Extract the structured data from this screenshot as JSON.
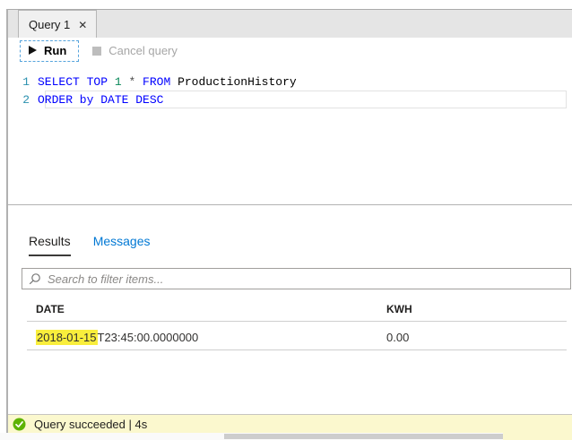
{
  "tab_bar": {
    "tabs": [
      {
        "label": "Query 1"
      }
    ],
    "close_icon": "✕"
  },
  "toolbar": {
    "run_label": "Run",
    "cancel_label": "Cancel query"
  },
  "editor": {
    "lines": [
      {
        "number": "1",
        "tokens": [
          {
            "text": "SELECT TOP ",
            "type": "keyword"
          },
          {
            "text": "1",
            "type": "number"
          },
          {
            "text": " * ",
            "type": "operator"
          },
          {
            "text": "FROM ",
            "type": "keyword"
          },
          {
            "text": "ProductionHistory",
            "type": "identifier"
          }
        ]
      },
      {
        "number": "2",
        "tokens": [
          {
            "text": "ORDER by DATE DESC",
            "type": "keyword"
          }
        ]
      }
    ]
  },
  "results_panel": {
    "tabs": [
      {
        "label": "Results",
        "active": true
      },
      {
        "label": "Messages",
        "active": false
      }
    ],
    "search": {
      "placeholder": "Search to filter items..."
    },
    "table": {
      "columns": [
        "DATE",
        "KWH"
      ],
      "rows": [
        {
          "date_highlighted": "2018-01-15",
          "date_rest": "T23:45:00.0000000",
          "kwh": "0.00"
        }
      ]
    }
  },
  "status_bar": {
    "text": "Query succeeded | 4s"
  },
  "colors": {
    "keyword_blue": "#0000ff",
    "number_green": "#09885a",
    "line_number_teal": "#2b91af",
    "link_blue": "#0078d4",
    "status_green": "#5db300",
    "highlight_yellow": "#f9ee3c",
    "statusbar_bg": "#fbf8ce"
  }
}
